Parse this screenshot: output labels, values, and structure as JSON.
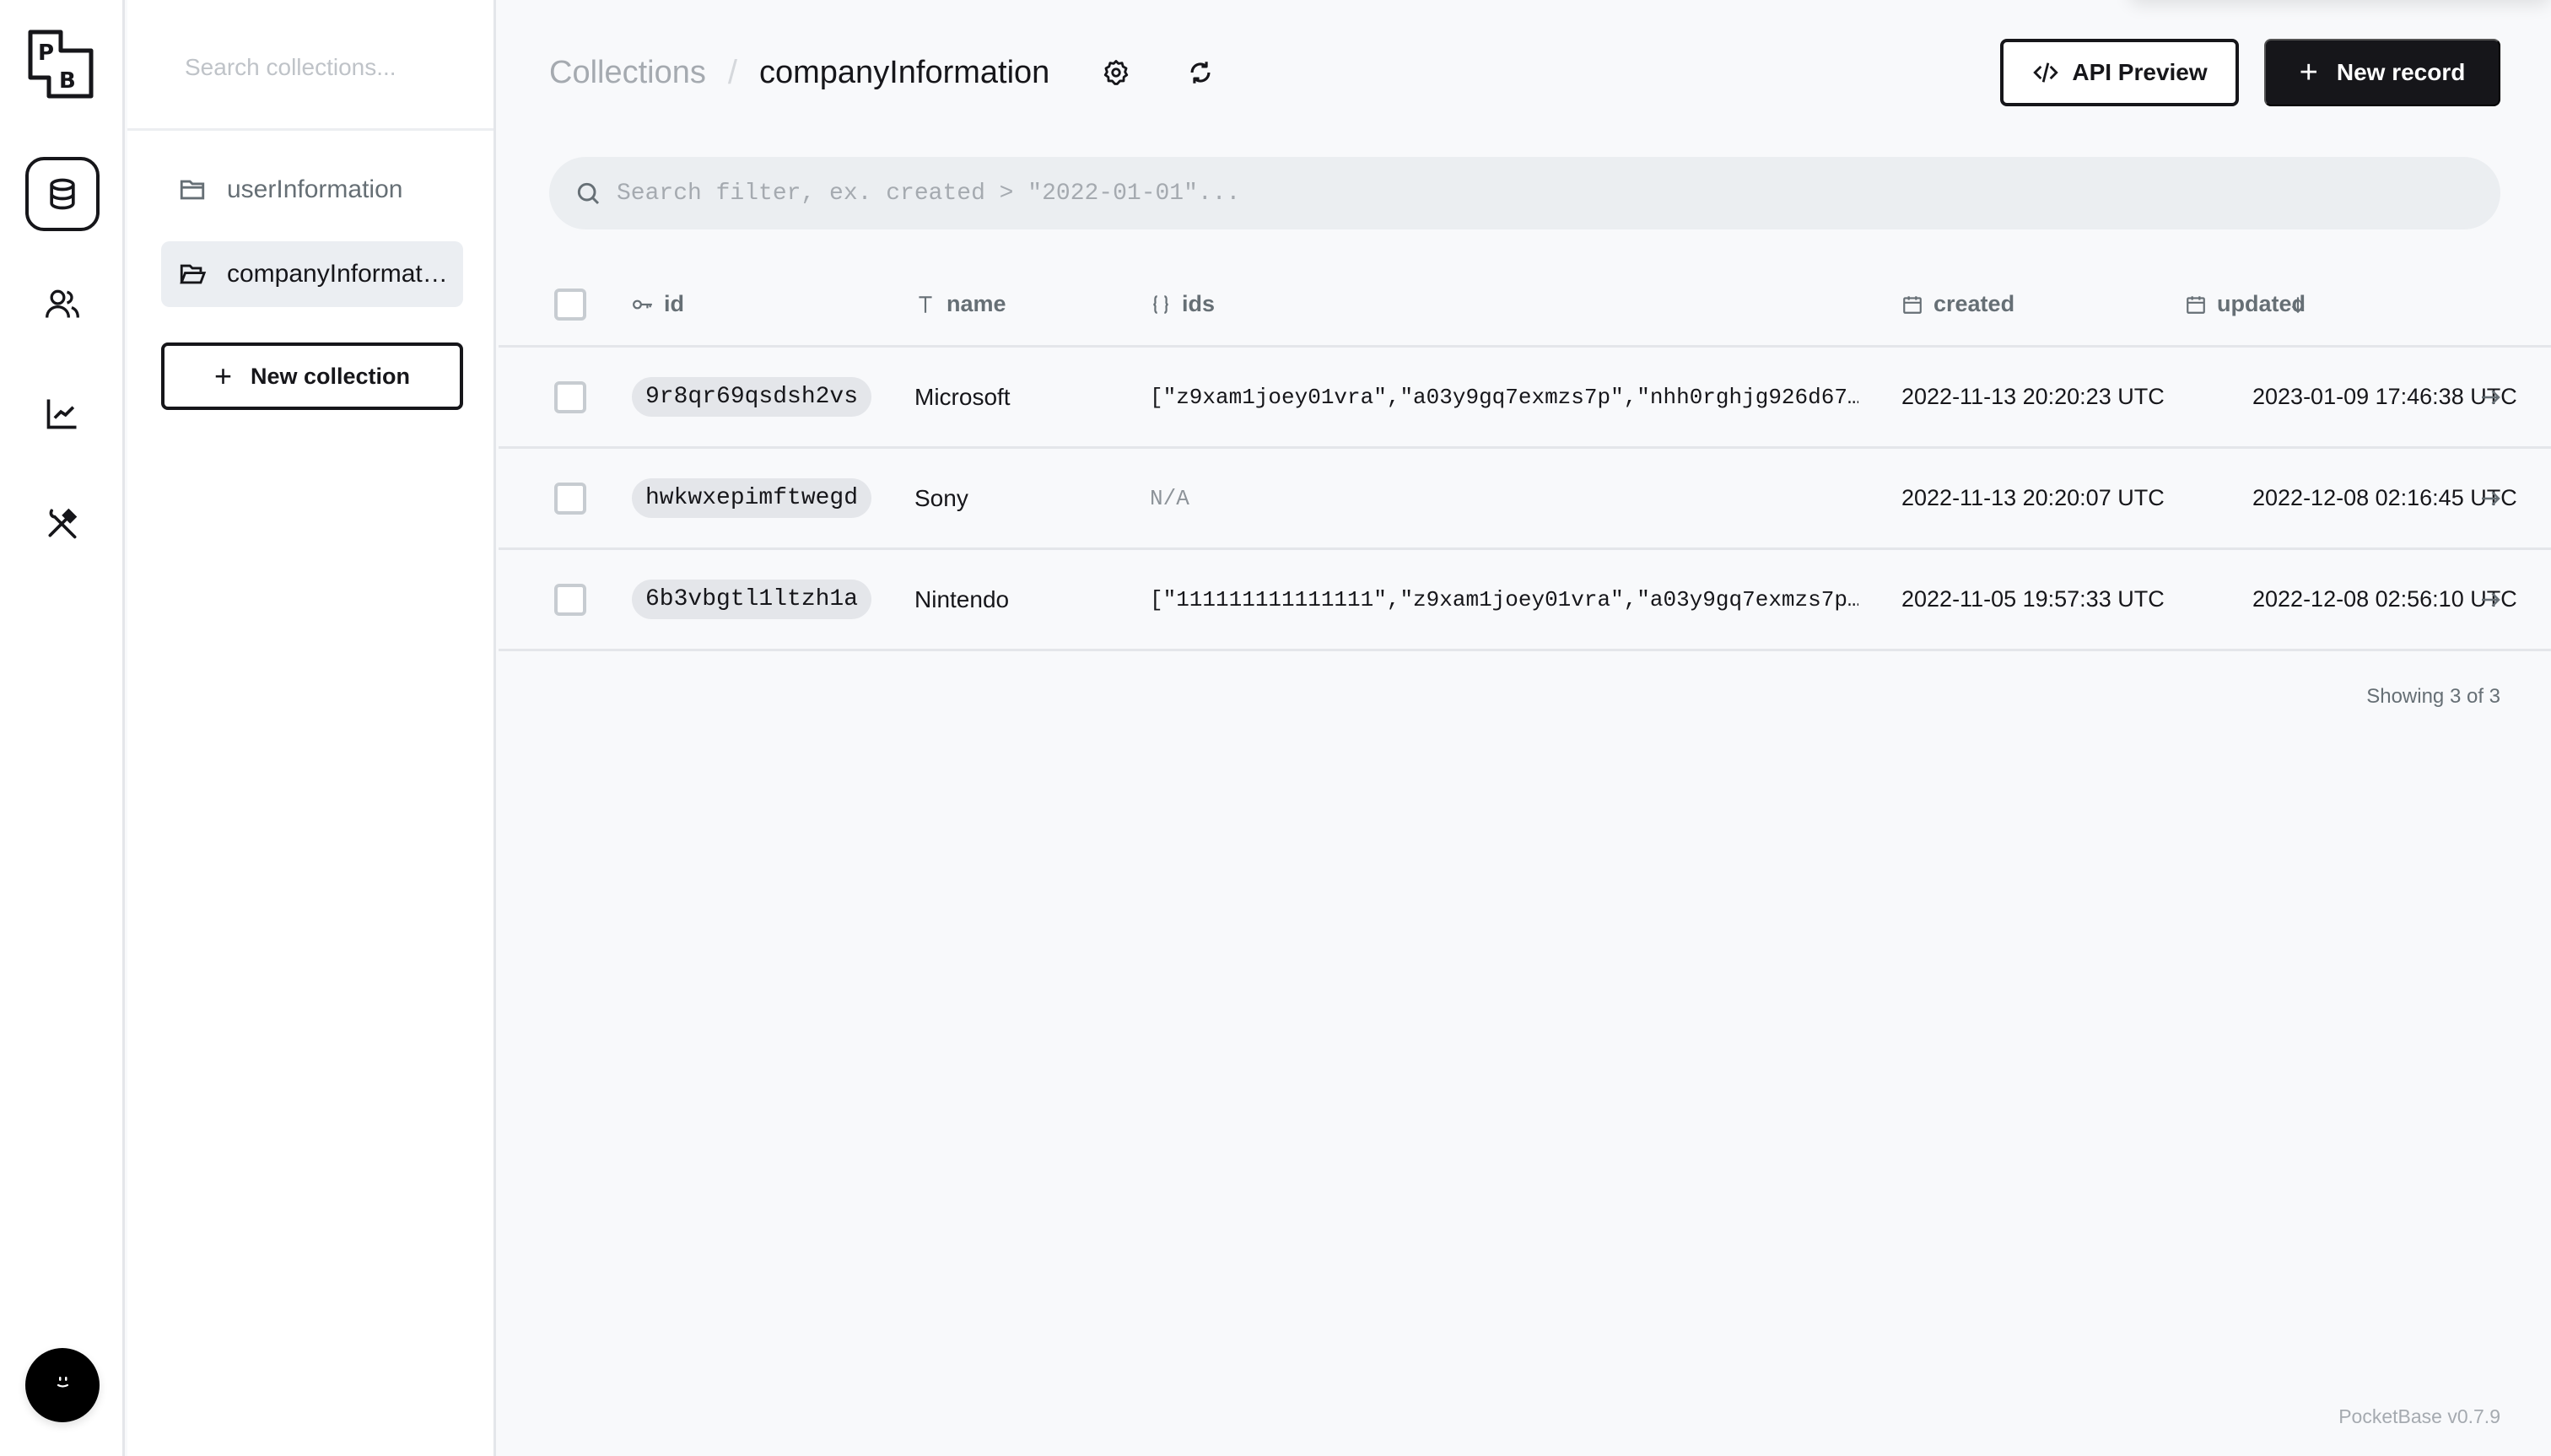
{
  "app": {
    "name": "PocketBase",
    "logo_letters": "PB",
    "version_label": "PocketBase v0.7.9"
  },
  "navbar": {
    "items": [
      {
        "name": "collections",
        "icon": "database-icon",
        "active": true
      },
      {
        "name": "users",
        "icon": "users-icon",
        "active": false
      },
      {
        "name": "logs",
        "icon": "line-chart-icon",
        "active": false
      },
      {
        "name": "settings",
        "icon": "tools-icon",
        "active": false
      }
    ],
    "avatar_icon": "smiley-face-icon"
  },
  "collections_panel": {
    "search_placeholder": "Search collections...",
    "items": [
      {
        "label": "userInformation",
        "icon": "folder-icon",
        "active": false
      },
      {
        "label": "companyInformation",
        "icon": "folder-open-icon",
        "active": true
      }
    ],
    "new_collection_label": "New collection"
  },
  "header": {
    "breadcrumb_root": "Collections",
    "breadcrumb_separator": "/",
    "breadcrumb_current": "companyInformation",
    "settings_icon": "gear-icon",
    "refresh_icon": "refresh-icon",
    "api_preview_label": "API Preview",
    "new_record_label": "New record"
  },
  "filter": {
    "placeholder": "Search filter, ex. created > \"2022-01-01\"...",
    "value": ""
  },
  "table": {
    "columns": [
      {
        "key": "id",
        "label": "id",
        "icon": "key-icon"
      },
      {
        "key": "name",
        "label": "name",
        "icon": "text-type-icon"
      },
      {
        "key": "ids",
        "label": "ids",
        "icon": "json-braces-icon"
      },
      {
        "key": "created",
        "label": "created",
        "icon": "calendar-icon",
        "sort": "desc"
      },
      {
        "key": "updated",
        "label": "updated",
        "icon": "calendar-icon"
      }
    ],
    "rows": [
      {
        "id": "9r8qr69qsdsh2vs",
        "name": "Microsoft",
        "ids": "[\"z9xam1joey01vra\",\"a03y9gq7exmzs7p\",\"nhh0rghjg926d67…",
        "created": "2022-11-13 20:20:23 UTC",
        "updated": "2023-01-09 17:46:38 UTC"
      },
      {
        "id": "hwkwxepimftwegd",
        "name": "Sony",
        "ids": "N/A",
        "created": "2022-11-13 20:20:07 UTC",
        "updated": "2022-12-08 02:16:45 UTC"
      },
      {
        "id": "6b3vbgtl1ltzh1a",
        "name": "Nintendo",
        "ids": "[\"111111111111111\",\"z9xam1joey01vra\",\"a03y9gq7exmzs7p…",
        "created": "2022-11-05 19:57:33 UTC",
        "updated": "2022-12-08 02:56:10 UTC"
      }
    ],
    "showing_text": "Showing 3 of 3"
  },
  "colors": {
    "primary": "#16161a",
    "background": "#f8f9fb",
    "muted_text": "#666f75",
    "border": "#e4e6ea"
  }
}
